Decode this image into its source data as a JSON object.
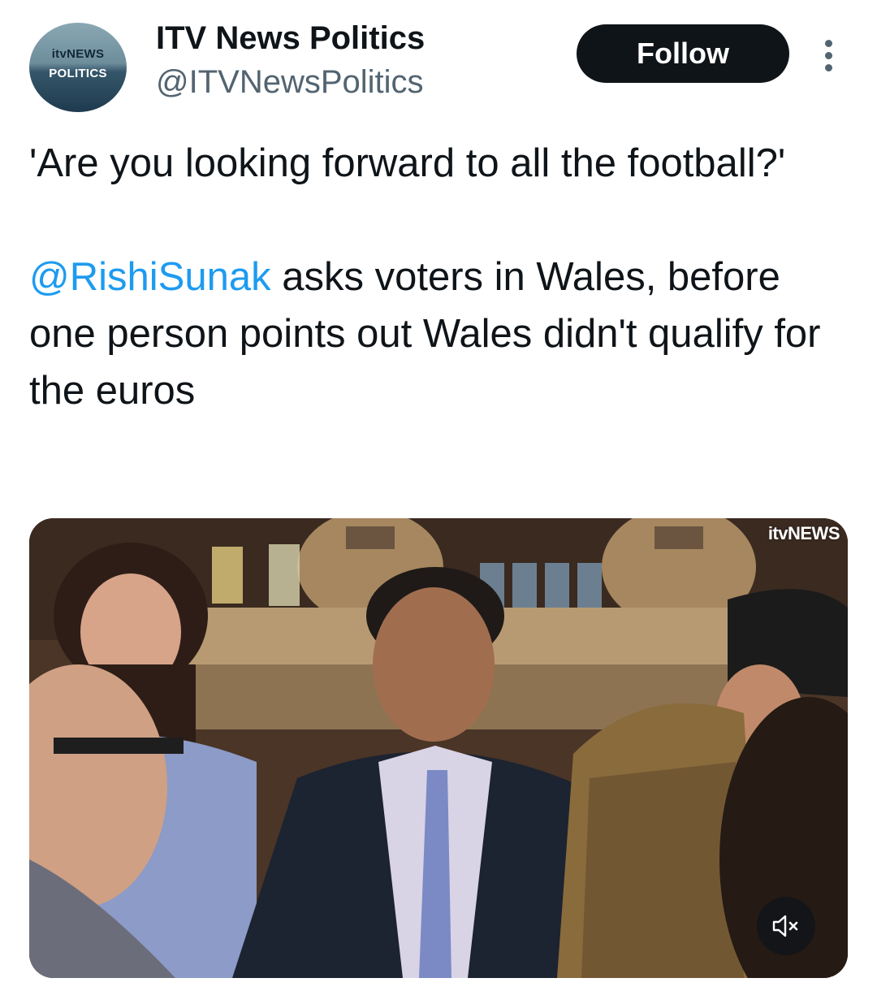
{
  "account": {
    "avatar_logo_line1": "itvNEWS",
    "avatar_logo_line2": "POLITICS",
    "display_name": "ITV News Politics",
    "handle": "@ITVNewsPolitics"
  },
  "header": {
    "follow_label": "Follow",
    "more_icon": "more-dots-vertical-icon"
  },
  "tweet": {
    "line_quote": "'Are you looking forward to all the football?'",
    "mention": "@RishiSunak",
    "text_after_mention": " asks voters in Wales, before one person points out Wales didn't qualify for the euros"
  },
  "media": {
    "watermark": "itvNEWS",
    "mute_icon": "speaker-muted-icon"
  },
  "colors": {
    "text": "#0f1419",
    "secondary": "#536471",
    "link": "#1d9bf0",
    "follow_bg": "#0f1419"
  }
}
